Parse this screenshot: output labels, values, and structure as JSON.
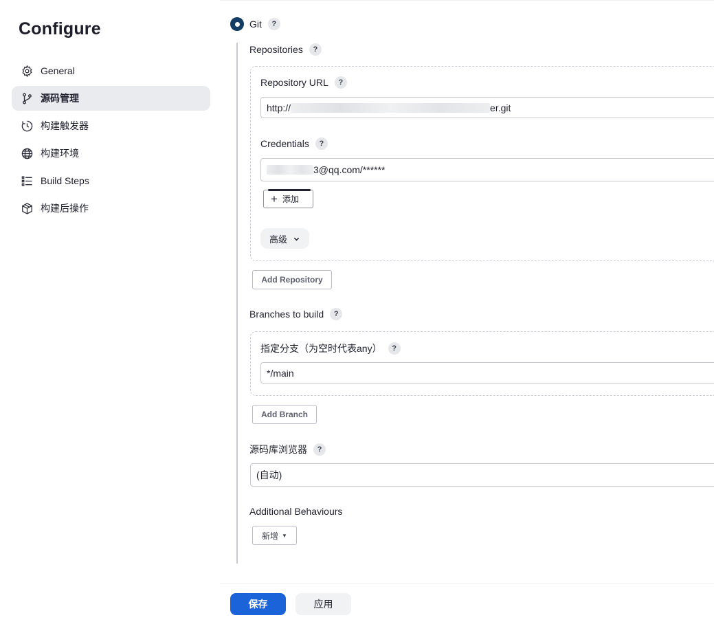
{
  "sidebar": {
    "title": "Configure",
    "items": [
      {
        "label": "General",
        "icon": "gear-icon"
      },
      {
        "label": "源码管理",
        "icon": "branch-icon",
        "active": true
      },
      {
        "label": "构建触发器",
        "icon": "clock-icon"
      },
      {
        "label": "构建环境",
        "icon": "globe-icon"
      },
      {
        "label": "Build Steps",
        "icon": "list-icon"
      },
      {
        "label": "构建后操作",
        "icon": "package-icon"
      }
    ]
  },
  "scm": {
    "option_label": "Git",
    "help": "?",
    "repositories": {
      "label": "Repositories",
      "url_label": "Repository URL",
      "url_prefix": "http://",
      "url_suffix": "er.git",
      "credentials_label": "Credentials",
      "credentials_suffix": "3@qq.com/******",
      "add_button": "添加",
      "advanced_button": "高级",
      "add_repository_button": "Add Repository"
    },
    "branches": {
      "label": "Branches to build",
      "specifier_label": "指定分支（为空时代表any）",
      "specifier_value": "*/main",
      "add_branch_button": "Add Branch"
    },
    "browser": {
      "label": "源码库浏览器",
      "value": "(自动)"
    },
    "behaviours": {
      "label": "Additional Behaviours",
      "add_button": "新增"
    }
  },
  "footer": {
    "save_label": "保存",
    "apply_label": "应用"
  },
  "colors": {
    "primary": "#1a63d8",
    "radio": "#143d66",
    "active_nav_bg": "#e9ebef"
  }
}
